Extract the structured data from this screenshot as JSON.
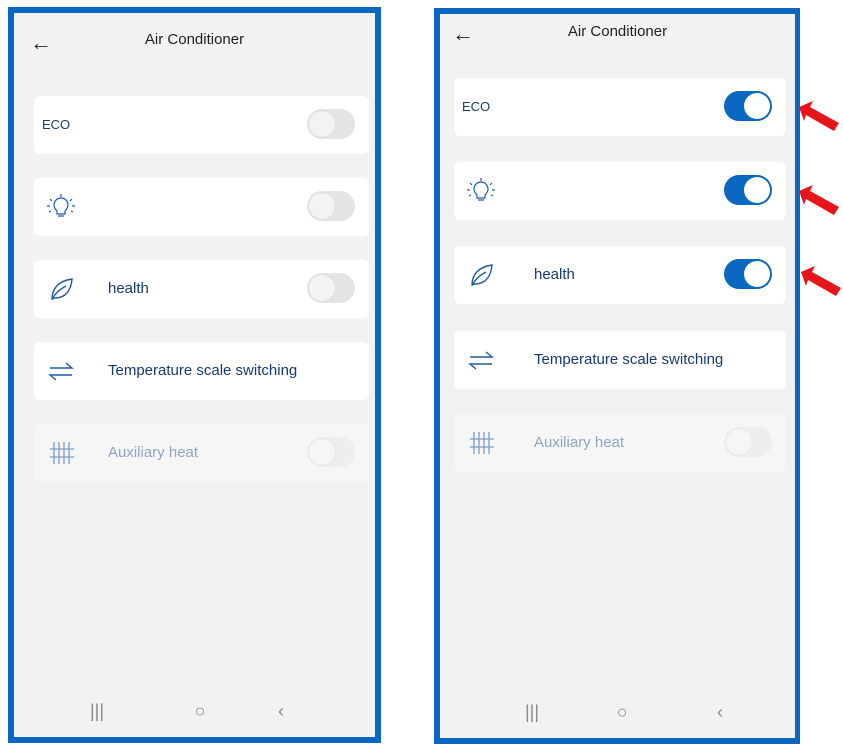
{
  "screens": [
    {
      "title": "Air Conditioner",
      "items": [
        {
          "label": "ECO",
          "icon": "none",
          "toggle": "off"
        },
        {
          "label": "",
          "icon": "lightbulb-icon",
          "toggle": "off"
        },
        {
          "label": "health",
          "icon": "leaf-icon",
          "toggle": "off"
        },
        {
          "label": "Temperature scale switching",
          "icon": "swap-arrows-icon",
          "toggle": "none"
        },
        {
          "label": "Auxiliary heat",
          "icon": "heater-grid-icon",
          "toggle": "disabled"
        }
      ]
    },
    {
      "title": "Air Conditioner",
      "items": [
        {
          "label": "ECO",
          "icon": "none",
          "toggle": "on"
        },
        {
          "label": "",
          "icon": "lightbulb-icon",
          "toggle": "on"
        },
        {
          "label": "health",
          "icon": "leaf-icon",
          "toggle": "on"
        },
        {
          "label": "Temperature scale switching",
          "icon": "swap-arrows-icon",
          "toggle": "none"
        },
        {
          "label": "Auxiliary heat",
          "icon": "heater-grid-icon",
          "toggle": "disabled"
        }
      ]
    }
  ],
  "navbar": {
    "recent": "|||",
    "home": "○",
    "back": "‹"
  },
  "colors": {
    "frame": "#0a67c2",
    "toggle_on": "#0a67c2",
    "annotation_arrow": "#e8141b"
  }
}
